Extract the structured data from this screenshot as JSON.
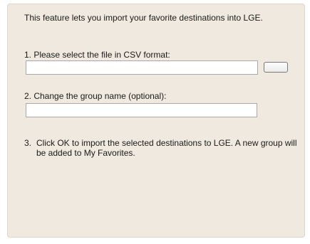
{
  "import_panel": {
    "intro_text": "This feature lets you import your favorite destinations into LGE.",
    "step1": {
      "label": "1.  Please select the file in CSV format:",
      "file_value": "",
      "browse_label": ""
    },
    "step2": {
      "label": "2.  Change the group name (optional):",
      "group_value": ""
    },
    "step3": {
      "number": "3.",
      "label": "Click OK to import the selected destinations to LGE. A new group will be added to My Favorites."
    }
  }
}
